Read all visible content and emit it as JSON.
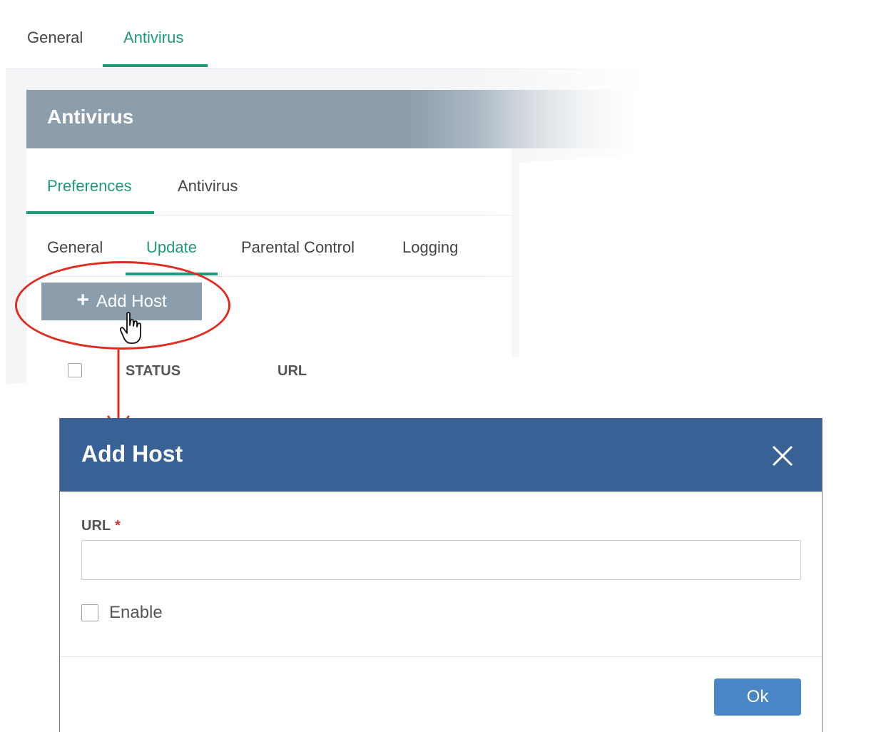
{
  "top_tabs": [
    {
      "label": "General",
      "active": false
    },
    {
      "label": "Antivirus",
      "active": true
    }
  ],
  "section_header": {
    "title": "Antivirus"
  },
  "sub_tabs": [
    {
      "label": "Preferences",
      "active": true
    },
    {
      "label": "Antivirus",
      "active": false
    }
  ],
  "sub_sub_tabs": [
    {
      "label": "General",
      "active": false
    },
    {
      "label": "Update",
      "active": true
    },
    {
      "label": "Parental Control",
      "active": false
    },
    {
      "label": "Logging",
      "active": false
    }
  ],
  "toolbar": {
    "add_host_label": "Add Host",
    "add_icon": "plus-icon"
  },
  "table": {
    "columns": [
      "STATUS",
      "URL"
    ]
  },
  "dialog": {
    "title": "Add Host",
    "close_icon": "close-icon",
    "url_label": "URL",
    "required_marker": "*",
    "url_value": "",
    "enable_label": "Enable",
    "enable_checked": false,
    "ok_label": "Ok"
  },
  "colors": {
    "accent": "#1e9a7a",
    "header_gray": "#8c9dac",
    "dialog_header": "#386195",
    "ok_button": "#4a86c6",
    "highlight": "#e02b20"
  }
}
